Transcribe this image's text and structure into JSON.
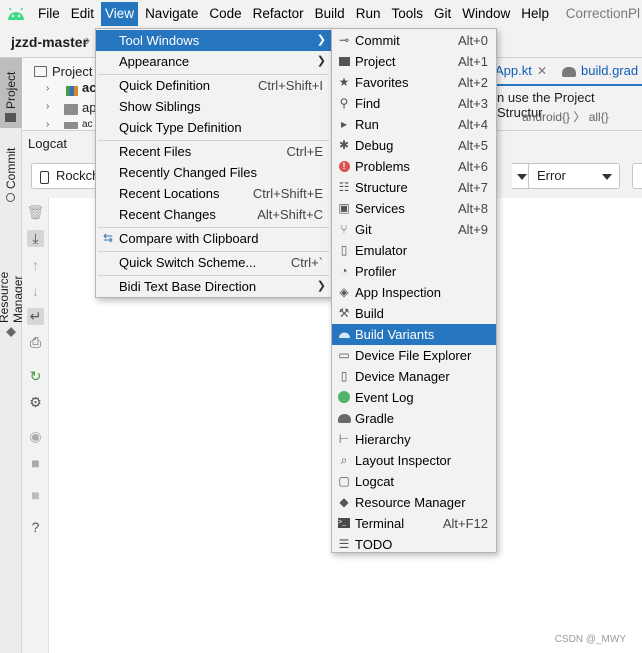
{
  "menubar": {
    "items": [
      "File",
      "Edit",
      "View",
      "Navigate",
      "Code",
      "Refactor",
      "Build",
      "Run",
      "Tools",
      "Git",
      "Window",
      "Help"
    ],
    "title": "CorrectionPl"
  },
  "breadcrumb": {
    "project": "jzzd-master"
  },
  "editor_tabs": {
    "tab1": "App.kt",
    "tab2": "build.grad"
  },
  "editor_hint": {
    "line1": "n use the Project Structur",
    "line2": "android{}  〉 all{}"
  },
  "stripe": {
    "project": "Project",
    "commit": "Commit",
    "resource_manager": "Resource Manager"
  },
  "project_panel": {
    "title": "Project",
    "row1": "ac",
    "row2": "ap",
    "row3": "ac"
  },
  "logcat": {
    "title": "Logcat",
    "device": "Rockch",
    "level": "Error",
    "watermark": "CSDN @_MWY"
  },
  "view_menu": {
    "items": [
      {
        "label": "Tool Windows",
        "shortcut": "",
        "submenu": true
      },
      {
        "label": "Appearance",
        "shortcut": "",
        "submenu": true
      },
      {
        "label": "Quick Definition",
        "shortcut": "Ctrl+Shift+I"
      },
      {
        "label": "Show Siblings",
        "shortcut": ""
      },
      {
        "label": "Quick Type Definition",
        "shortcut": ""
      },
      {
        "label": "Recent Files",
        "shortcut": "Ctrl+E"
      },
      {
        "label": "Recently Changed Files",
        "shortcut": ""
      },
      {
        "label": "Recent Locations",
        "shortcut": "Ctrl+Shift+E"
      },
      {
        "label": "Recent Changes",
        "shortcut": "Alt+Shift+C"
      },
      {
        "label": "Compare with Clipboard",
        "shortcut": ""
      },
      {
        "label": "Quick Switch Scheme...",
        "shortcut": "Ctrl+`"
      },
      {
        "label": "Bidi Text Base Direction",
        "shortcut": "",
        "submenu": true
      }
    ]
  },
  "tool_windows_menu": {
    "items": [
      {
        "label": "Commit",
        "shortcut": "Alt+0",
        "icon": "commit-icon"
      },
      {
        "label": "Project",
        "shortcut": "Alt+1",
        "icon": "folder-icon"
      },
      {
        "label": "Favorites",
        "shortcut": "Alt+2",
        "icon": "star-icon"
      },
      {
        "label": "Find",
        "shortcut": "Alt+3",
        "icon": "search-icon"
      },
      {
        "label": "Run",
        "shortcut": "Alt+4",
        "icon": "run-icon"
      },
      {
        "label": "Debug",
        "shortcut": "Alt+5",
        "icon": "bug-icon"
      },
      {
        "label": "Problems",
        "shortcut": "Alt+6",
        "icon": "error-icon"
      },
      {
        "label": "Structure",
        "shortcut": "Alt+7",
        "icon": "structure-icon"
      },
      {
        "label": "Services",
        "shortcut": "Alt+8",
        "icon": "services-icon"
      },
      {
        "label": "Git",
        "shortcut": "Alt+9",
        "icon": "git-icon"
      },
      {
        "label": "Emulator",
        "shortcut": "",
        "icon": "emulator-icon"
      },
      {
        "label": "Profiler",
        "shortcut": "",
        "icon": "profiler-icon"
      },
      {
        "label": "App Inspection",
        "shortcut": "",
        "icon": "inspection-icon"
      },
      {
        "label": "Build",
        "shortcut": "",
        "icon": "hammer-icon"
      },
      {
        "label": "Build Variants",
        "shortcut": "",
        "icon": "android-icon"
      },
      {
        "label": "Device File Explorer",
        "shortcut": "",
        "icon": "file-explorer-icon"
      },
      {
        "label": "Device Manager",
        "shortcut": "",
        "icon": "device-manager-icon"
      },
      {
        "label": "Event Log",
        "shortcut": "",
        "icon": "event-log-icon"
      },
      {
        "label": "Gradle",
        "shortcut": "",
        "icon": "gradle-icon"
      },
      {
        "label": "Hierarchy",
        "shortcut": "",
        "icon": "hierarchy-icon"
      },
      {
        "label": "Layout Inspector",
        "shortcut": "",
        "icon": "layout-inspector-icon"
      },
      {
        "label": "Logcat",
        "shortcut": "",
        "icon": "logcat-icon"
      },
      {
        "label": "Resource Manager",
        "shortcut": "",
        "icon": "resource-manager-icon"
      },
      {
        "label": "Terminal",
        "shortcut": "Alt+F12",
        "icon": "terminal-icon"
      },
      {
        "label": "TODO",
        "shortcut": "",
        "icon": "todo-icon"
      }
    ]
  },
  "colors": {
    "accent": "#2675bf",
    "menu_bg": "#f2f2f2",
    "link": "#0d5db8"
  }
}
